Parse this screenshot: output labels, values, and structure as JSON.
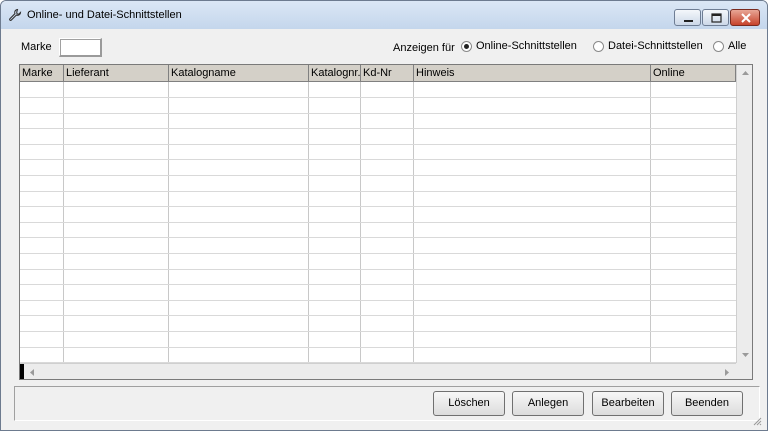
{
  "window": {
    "title": "Online- und Datei-Schnittstellen"
  },
  "filter": {
    "marke_label": "Marke",
    "marke_value": "",
    "show_label": "Anzeigen für",
    "options": [
      {
        "label": "Online-Schnittstellen",
        "selected": true
      },
      {
        "label": "Datei-Schnittstellen",
        "selected": false
      },
      {
        "label": "Alle",
        "selected": false
      }
    ]
  },
  "table": {
    "columns": [
      "Marke",
      "Lieferant",
      "Katalogname",
      "Katalognr.",
      "Kd-Nr",
      "Hinweis",
      "Online"
    ],
    "rows": []
  },
  "buttons": {
    "delete": "Löschen",
    "create": "Anlegen",
    "edit": "Bearbeiten",
    "exit": "Beenden"
  },
  "colors": {
    "window_bg": "#f0f0f0",
    "header_bg": "#d4d0c8",
    "close_button": "#c7432b"
  }
}
